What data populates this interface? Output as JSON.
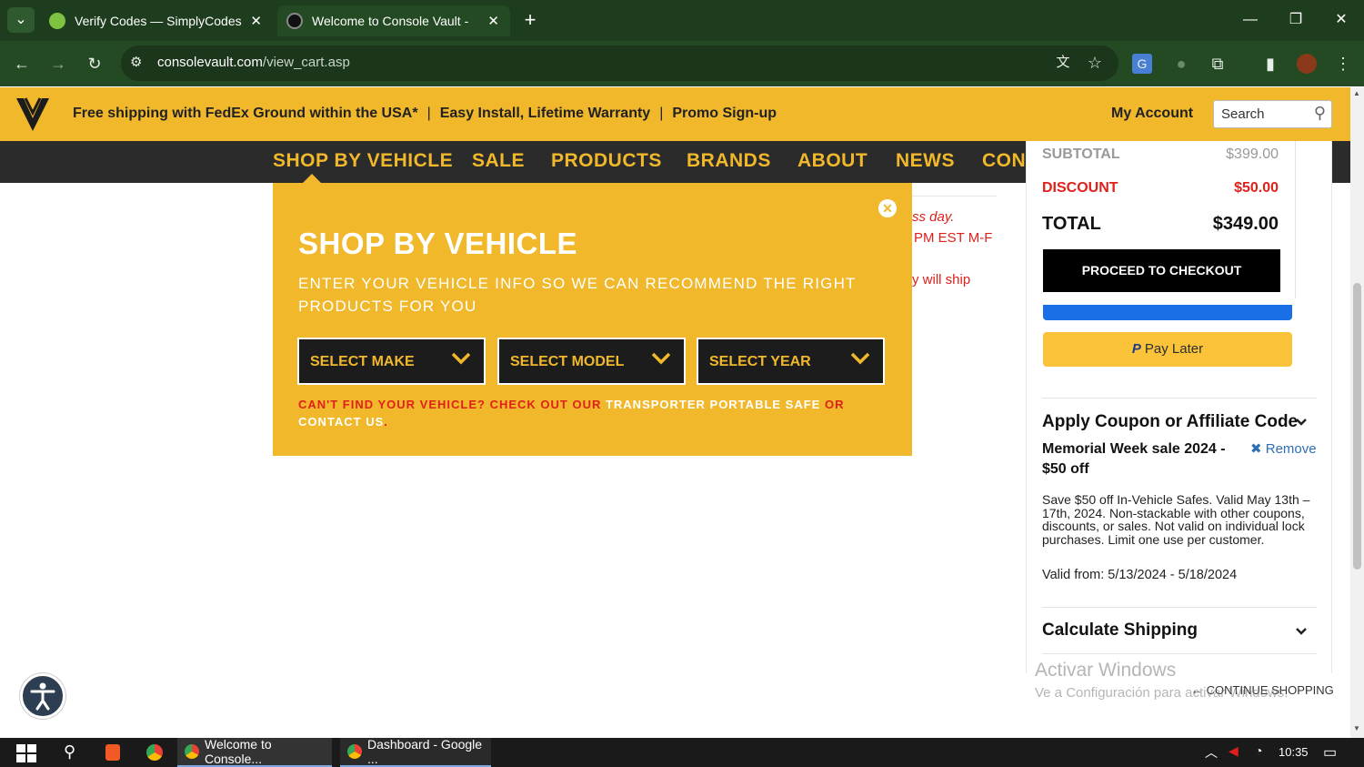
{
  "browser": {
    "tabs": [
      {
        "title": "Verify Codes — SimplyCodes",
        "active": false
      },
      {
        "title": "Welcome to Console Vault -",
        "active": true
      }
    ],
    "new_tab_glyph": "+",
    "url_domain": "consolevault.com",
    "url_path": "/view_cart.asp"
  },
  "header": {
    "promo": [
      "Free shipping with FedEx Ground within the USA*",
      "Easy Install, Lifetime Warranty",
      "Promo Sign-up"
    ],
    "separator": "|",
    "my_account": "My Account",
    "search_placeholder": "Search"
  },
  "nav": {
    "items": [
      "SHOP BY VEHICLE",
      "SALE",
      "PRODUCTS",
      "BRANDS",
      "ABOUT",
      "NEWS",
      "CON"
    ]
  },
  "shop_by_vehicle": {
    "title": "SHOP BY VEHICLE",
    "subtitle": "ENTER YOUR VEHICLE INFO SO WE CAN RECOMMEND THE RIGHT PRODUCTS FOR YOU",
    "selects": [
      "SELECT MAKE",
      "SELECT MODEL",
      "SELECT YEAR"
    ],
    "footer_red1": "CAN'T FIND YOUR VEHICLE? CHECK OUT OUR ",
    "footer_link1": "TRANSPORTER PORTABLE SAFE",
    "footer_red2": " OR ",
    "footer_link2": "CONTACT US",
    "footer_end": "."
  },
  "background_text": {
    "line1": "ss day.",
    "line2": "PM EST M-F",
    "line3": "y will ship"
  },
  "cart": {
    "subtotal_label": "SUBTOTAL",
    "subtotal_value": "$399.00",
    "discount_label": "DISCOUNT",
    "discount_value": "$50.00",
    "total_label": "TOTAL",
    "total_value": "$349.00",
    "checkout_label": "PROCEED TO CHECKOUT",
    "pay_later_label": "Pay Later",
    "coupon_heading": "Apply Coupon or Affiliate Code",
    "coupon_name": "Memorial Week sale 2024 - $50 off",
    "remove_label": "Remove",
    "coupon_desc": "Save $50 off In-Vehicle Safes. Valid May 13th – 17th, 2024. Non-stackable with other coupons, discounts, or sales. Not valid on individual lock purchases. Limit one use per customer.",
    "valid_from": "Valid from: 5/13/2024 - 5/18/2024",
    "shipping_heading": "Calculate Shipping",
    "continue_shopping": "CONTINUE SHOPPING"
  },
  "watermark": {
    "line1": "Activar Windows",
    "line2": "Ve a Configuración para activar Windows."
  },
  "taskbar": {
    "items": [
      "Welcome to Console...",
      "Dashboard - Google ..."
    ],
    "time": "10:35"
  },
  "colors": {
    "brand_yellow": "#f0b82a",
    "nav_dark": "#2b2b2b",
    "browser_green": "#234a23",
    "discount_red": "#e0211b"
  }
}
